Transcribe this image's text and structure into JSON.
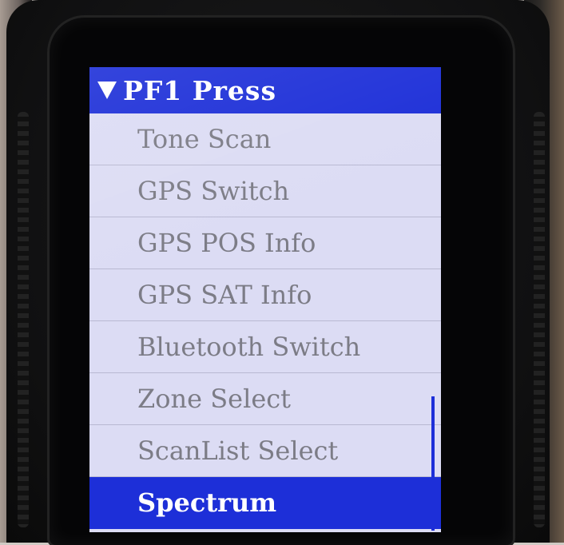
{
  "menu": {
    "title": "PF1 Press",
    "items": [
      {
        "label": "Tone Scan"
      },
      {
        "label": "GPS Switch"
      },
      {
        "label": "GPS POS Info"
      },
      {
        "label": "GPS SAT Info"
      },
      {
        "label": "Bluetooth Switch"
      },
      {
        "label": "Zone Select"
      },
      {
        "label": "ScanList Select"
      },
      {
        "label": "Spectrum",
        "selected": true
      }
    ]
  },
  "colors": {
    "highlight": "#1d2fd8",
    "screen_background": "#dcdcf4",
    "item_text": "#7c7c86"
  }
}
